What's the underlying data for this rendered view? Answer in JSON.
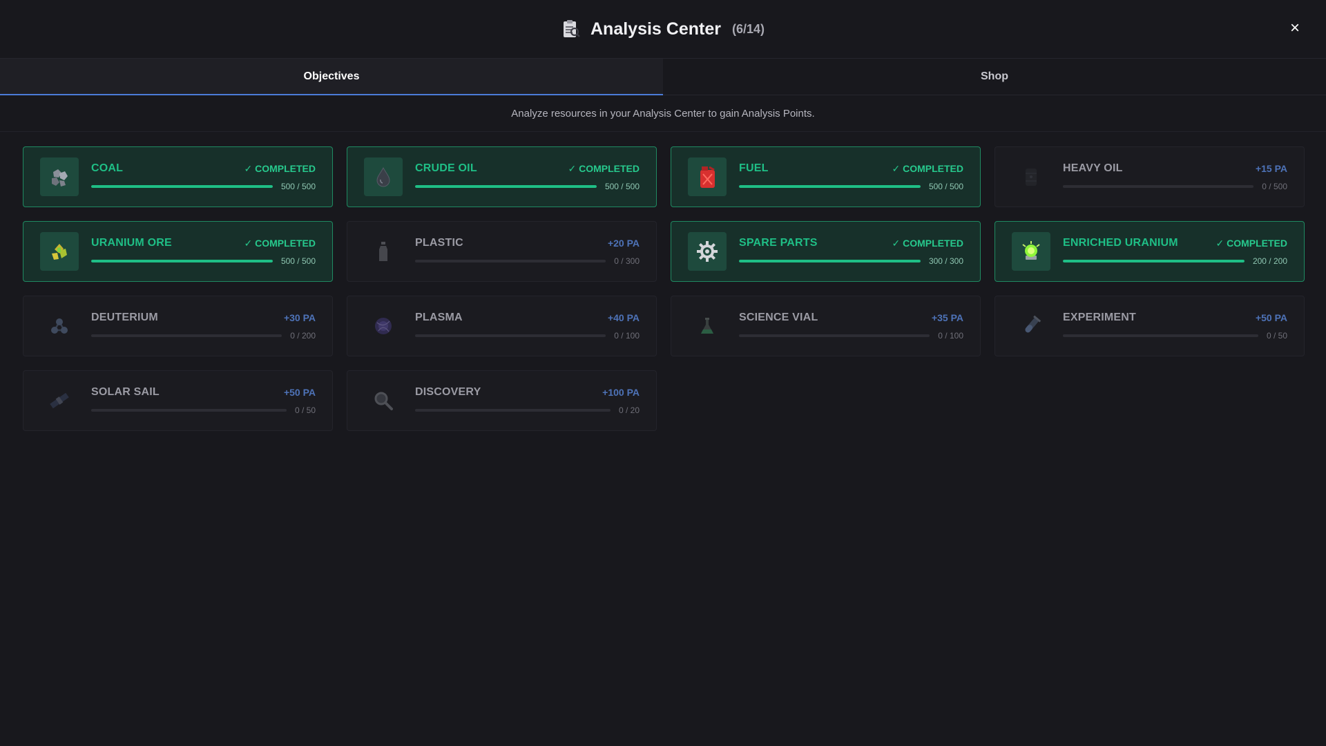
{
  "header": {
    "title": "Analysis Center",
    "count": "(6/14)",
    "icon": "clipboard-magnifier-icon",
    "close_label": "×"
  },
  "tabs": [
    {
      "label": "Objectives",
      "active": true
    },
    {
      "label": "Shop",
      "active": false
    }
  ],
  "subtitle": "Analyze resources in your Analysis Center to gain Analysis Points.",
  "colors": {
    "completed": "#1fbf86",
    "reward": "#4e73b8",
    "accent_tab": "#4b7bd8"
  },
  "objectives": [
    {
      "name": "COAL",
      "status": "✓ COMPLETED",
      "progress": "500 / 500",
      "fraction": 1,
      "completed": true,
      "icon": "coal-icon"
    },
    {
      "name": "CRUDE OIL",
      "status": "✓ COMPLETED",
      "progress": "500 / 500",
      "fraction": 1,
      "completed": true,
      "icon": "oil-drop-icon"
    },
    {
      "name": "FUEL",
      "status": "✓ COMPLETED",
      "progress": "500 / 500",
      "fraction": 1,
      "completed": true,
      "icon": "fuel-can-icon"
    },
    {
      "name": "HEAVY OIL",
      "status": "+15 PA",
      "progress": "0 / 500",
      "fraction": 0,
      "completed": false,
      "icon": "heavy-oil-barrel-icon"
    },
    {
      "name": "URANIUM ORE",
      "status": "✓ COMPLETED",
      "progress": "500 / 500",
      "fraction": 1,
      "completed": true,
      "icon": "uranium-ore-icon"
    },
    {
      "name": "PLASTIC",
      "status": "+20 PA",
      "progress": "0 / 300",
      "fraction": 0,
      "completed": false,
      "icon": "plastic-bottle-icon"
    },
    {
      "name": "SPARE PARTS",
      "status": "✓ COMPLETED",
      "progress": "300 / 300",
      "fraction": 1,
      "completed": true,
      "icon": "gear-icon"
    },
    {
      "name": "ENRICHED URANIUM",
      "status": "✓ COMPLETED",
      "progress": "200 / 200",
      "fraction": 1,
      "completed": true,
      "icon": "enriched-uranium-icon"
    },
    {
      "name": "DEUTERIUM",
      "status": "+30 PA",
      "progress": "0 / 200",
      "fraction": 0,
      "completed": false,
      "icon": "molecule-icon"
    },
    {
      "name": "PLASMA",
      "status": "+40 PA",
      "progress": "0 / 100",
      "fraction": 0,
      "completed": false,
      "icon": "plasma-orb-icon"
    },
    {
      "name": "SCIENCE VIAL",
      "status": "+35 PA",
      "progress": "0 / 100",
      "fraction": 0,
      "completed": false,
      "icon": "flask-icon"
    },
    {
      "name": "EXPERIMENT",
      "status": "+50 PA",
      "progress": "0 / 50",
      "fraction": 0,
      "completed": false,
      "icon": "test-tube-icon"
    },
    {
      "name": "SOLAR SAIL",
      "status": "+50 PA",
      "progress": "0 / 50",
      "fraction": 0,
      "completed": false,
      "icon": "solar-sail-icon"
    },
    {
      "name": "DISCOVERY",
      "status": "+100 PA",
      "progress": "0 / 20",
      "fraction": 0,
      "completed": false,
      "icon": "magnifier-icon"
    }
  ]
}
